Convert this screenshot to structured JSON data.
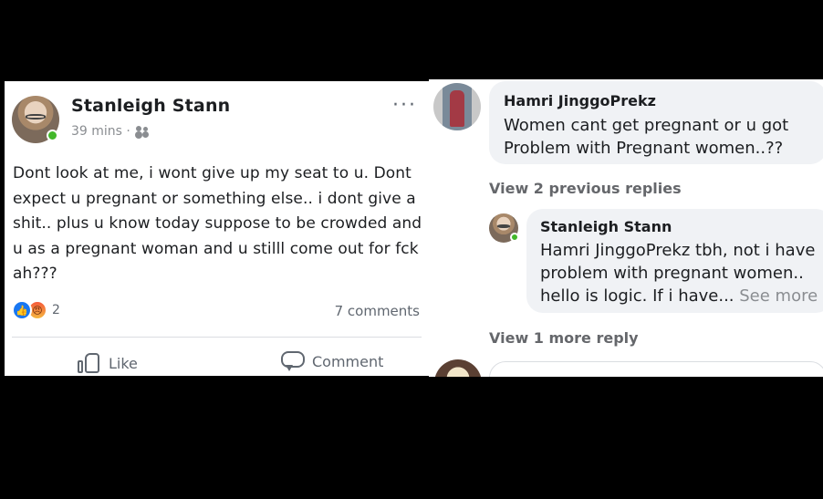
{
  "post": {
    "author": "Stanleigh Stann",
    "time": "39 mins ·",
    "audience_icon": "friends-icon",
    "menu_icon": "more-horizontal-icon",
    "menu_glyph": "···",
    "text": "Dont look at me, i wont give up my seat to u. Dont expect u pregnant or something else.. i dont give a shit.. plus u know today suppose to be crowded and u as a pregnant woman and u stilll come out for fck ah???",
    "reactions": {
      "icons": [
        "like-reaction-icon",
        "angry-reaction-icon"
      ],
      "count": "2"
    },
    "comments_count": "7 comments",
    "actions": {
      "like_label": "Like",
      "comment_label": "Comment"
    }
  },
  "comments": {
    "first": {
      "author": "Hamri JinggoPrekz",
      "text": "Women cant get pregnant or u got Problem with Pregnant women..??"
    },
    "view_previous": "View 2 previous replies",
    "reply": {
      "author": "Stanleigh Stann",
      "text": "Hamri JinggoPrekz tbh, not i have problem with pregnant women.. hello is logic. If i have... ",
      "see_more": "See more"
    },
    "view_more": "View 1 more reply"
  },
  "colors": {
    "brand_blue": "#1877f2",
    "online_green": "#42b72a",
    "bubble_gray": "#f0f2f5",
    "muted_text": "#65676b"
  }
}
